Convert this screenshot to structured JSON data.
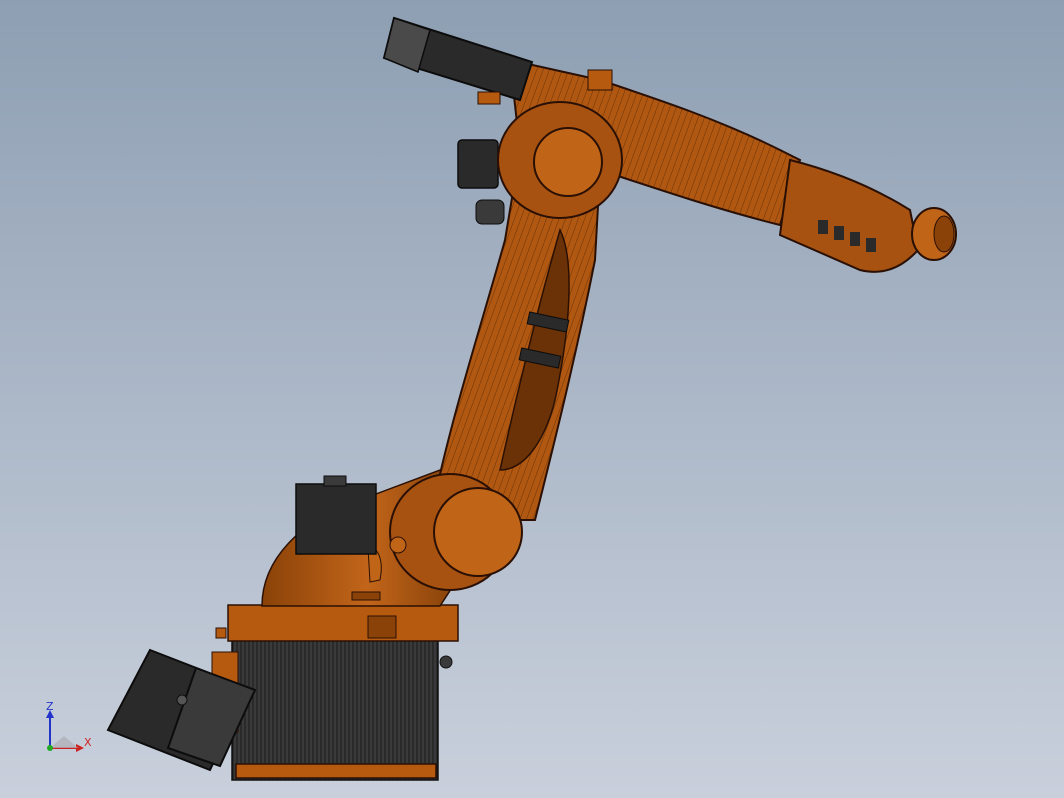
{
  "viewport": {
    "background_top": "#8e9fb3",
    "background_bottom": "#c9d0dc"
  },
  "colors": {
    "robot_orange": "#b65a10",
    "robot_orange_dark": "#5a2a06",
    "robot_orange_light": "#d07a2a",
    "motor_black": "#2a2a2a",
    "motor_grey": "#4a4a4a",
    "base_grey": "#3c3c3c",
    "edge": "#1a0c02"
  },
  "triad": {
    "z_label": "Z",
    "x_label": "X",
    "z_color": "#2233cc",
    "x_color": "#cc2222"
  }
}
